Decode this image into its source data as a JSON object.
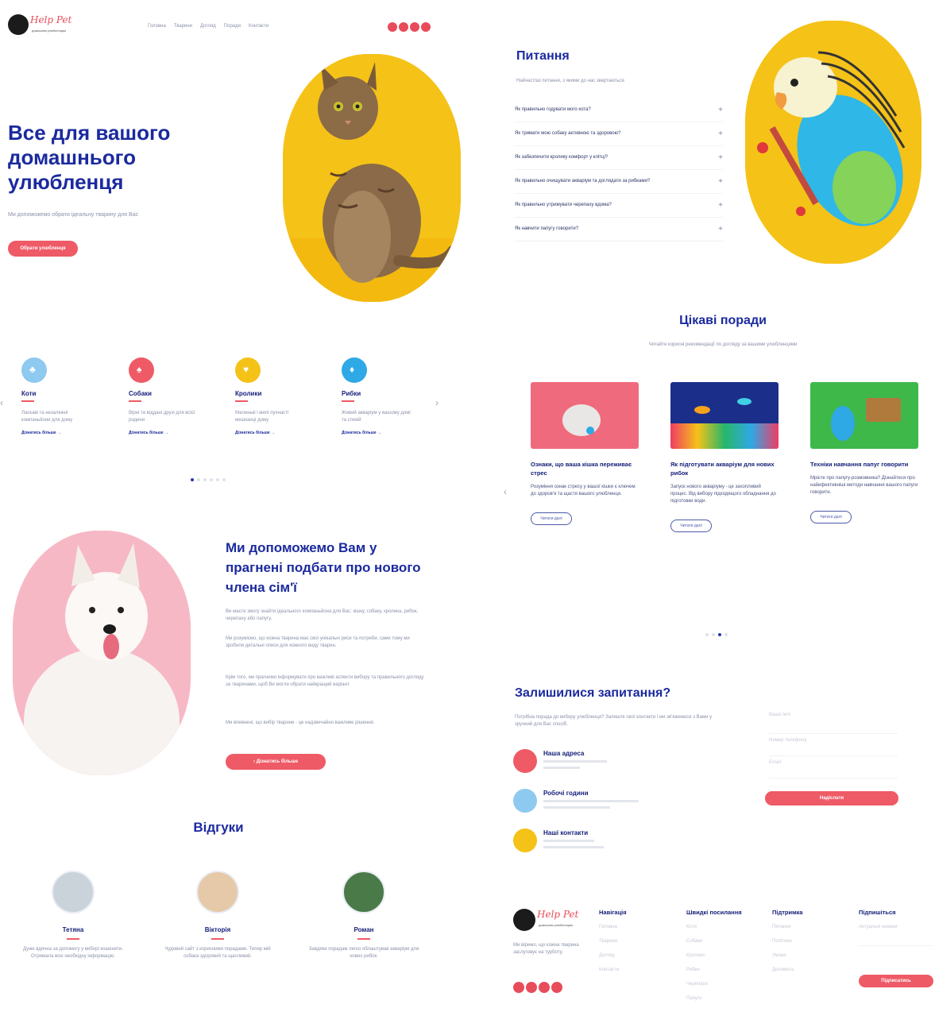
{
  "brand": {
    "name": "Help Pet",
    "tagline": "домашнім улюбленцям"
  },
  "nav": {
    "items": [
      "Головна",
      "Тварини",
      "Догляд",
      "Поради",
      "Контакти"
    ]
  },
  "hero": {
    "title": "Все для вашого домашнього улюбленця",
    "subtitle": "Ми допоможемо обрати ідеальну тварину для Вас",
    "cta": "Обрати улюбленця"
  },
  "categories": {
    "items": [
      {
        "label": "Коти",
        "text": "Ласкаві та незалежні компаньйони для дому",
        "more": "Дізнатись більше"
      },
      {
        "label": "Собаки",
        "text": "Вірні та віддані друзі для всієї родини",
        "more": "Дізнатись більше"
      },
      {
        "label": "Кролики",
        "text": "Маленькі і милі пухнасті мешканці дому",
        "more": "Дізнатись більше"
      },
      {
        "label": "Рибки",
        "text": "Живий акваріум у вашому домі та спокій",
        "more": "Дізнатись більше"
      }
    ],
    "colors": [
      "#8ec9ef",
      "#ee5a66",
      "#f5c218",
      "#2fa8e6"
    ]
  },
  "help": {
    "title": "Ми допоможемо Вам у прагнені подбати про нового члена сім'ї",
    "p1": "Ви маєте змогу знайти ідеального компаньйона для Вас: кішку, собаку, кролика, рибок, черепаху або папугу.",
    "p2": "Ми розуміємо, що кожна тварина має свої унікальні риси та потреби, саме тому ми зробили детальні описи для кожного виду тварин.",
    "p3": "Крім того, ми прагнемо інформувати про важливі аспекти вибору та правильного догляду за тваринами, щоб Ви могли обрати найкращий варіант.",
    "p4": "Ми впевнені, що вибір тварини - це надзвичайно важливе рішення.",
    "cta": "Дізнатись більше"
  },
  "reviews": {
    "title": "Відгуки",
    "items": [
      {
        "name": "Тетяна",
        "text": "Дуже вдячна за допомогу у виборі кошеняти. Отримала всю необхідну інформацію."
      },
      {
        "name": "Вікторія",
        "text": "Чудовий сайт з корисними порадами. Тепер мій собака здоровий та щасливий."
      },
      {
        "name": "Роман",
        "text": "Завдяки порадам легко облаштував акваріум для нових рибок."
      }
    ]
  },
  "faq": {
    "title": "Питання",
    "subtitle": "Найчастіші питання, з якими до нас звертаються",
    "items": [
      "Як правильно годувати мого кота?",
      "Як тримати мою собаку активною та здоровою?",
      "Як забезпечити кролику комфорт у клітці?",
      "Як правильно очищувати акваріум та доглядати за рибками?",
      "Як правильно утримувати черепаху вдома?",
      "Як навчити папугу говорити?"
    ]
  },
  "tips": {
    "title": "Цікаві поради",
    "subtitle": "Читайте корисні рекомендації по догляду за вашими улюбленцями",
    "items": [
      {
        "title": "Ознаки, що ваша кішка переживає стрес",
        "text": "Розуміння ознак стресу у вашої кішки є ключем до здоров'я та щастя вашого улюбленця.",
        "cta": "Читати далі"
      },
      {
        "title": "Як підготувати акваріум для нових рибок",
        "text": "Запуск нового акваріуму - це захопливий процес. Від вибору підходящого обладнання до підготовки води.",
        "cta": "Читати далі"
      },
      {
        "title": "Техніки навчання папуг говорити",
        "text": "Мрієте про папугу-розмовника? Дізнайтеся про найефективніші методи навчання вашого папуги говорити.",
        "cta": "Читати далі"
      }
    ]
  },
  "contact": {
    "title": "Залишилися запитання?",
    "subtitle": "Потрібна порада до вибору улюбленця? Залиште свої контакти і ми зв'яжемося з Вами у зручний для Вас спосіб.",
    "address_label": "Наша адреса",
    "hours_label": "Робочі години",
    "contacts_label": "Наші контакти",
    "form": {
      "name": "Ваше ім'я",
      "phone": "Номер телефону",
      "email": "Email",
      "submit": "Надіслати"
    }
  },
  "footer": {
    "about": "Ми віримо, що кожна тварина заслуговує на турботу.",
    "nav_title": "Навігація",
    "nav_items": [
      "Головна",
      "Тварини",
      "Догляд",
      "Контакти"
    ],
    "links_title": "Швидкі посилання",
    "links_items": [
      "Коти",
      "Собаки",
      "Кролики",
      "Рибки",
      "Черепахи",
      "Папуги"
    ],
    "support_title": "Підтримка",
    "support_items": [
      "Питання",
      "Політика",
      "Умови",
      "Допомога"
    ],
    "subscribe_title": "Підпишіться",
    "subscribe_text": "Актуальні новини",
    "subscribe_button": "Підписатись"
  }
}
